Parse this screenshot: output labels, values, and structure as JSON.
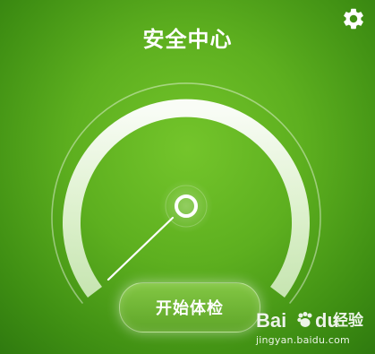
{
  "header": {
    "title": "安全中心",
    "settings_icon": "gear-icon"
  },
  "gauge": {
    "level_fraction": 0.0,
    "accent_color": "#ffffff",
    "background_color": "#5daf1f"
  },
  "actions": {
    "start_label": "开始体检"
  },
  "watermark": {
    "brand_left": "Bai",
    "brand_right": "du",
    "brand_suffix": "经验",
    "url": "jingyan.baidu.com"
  }
}
